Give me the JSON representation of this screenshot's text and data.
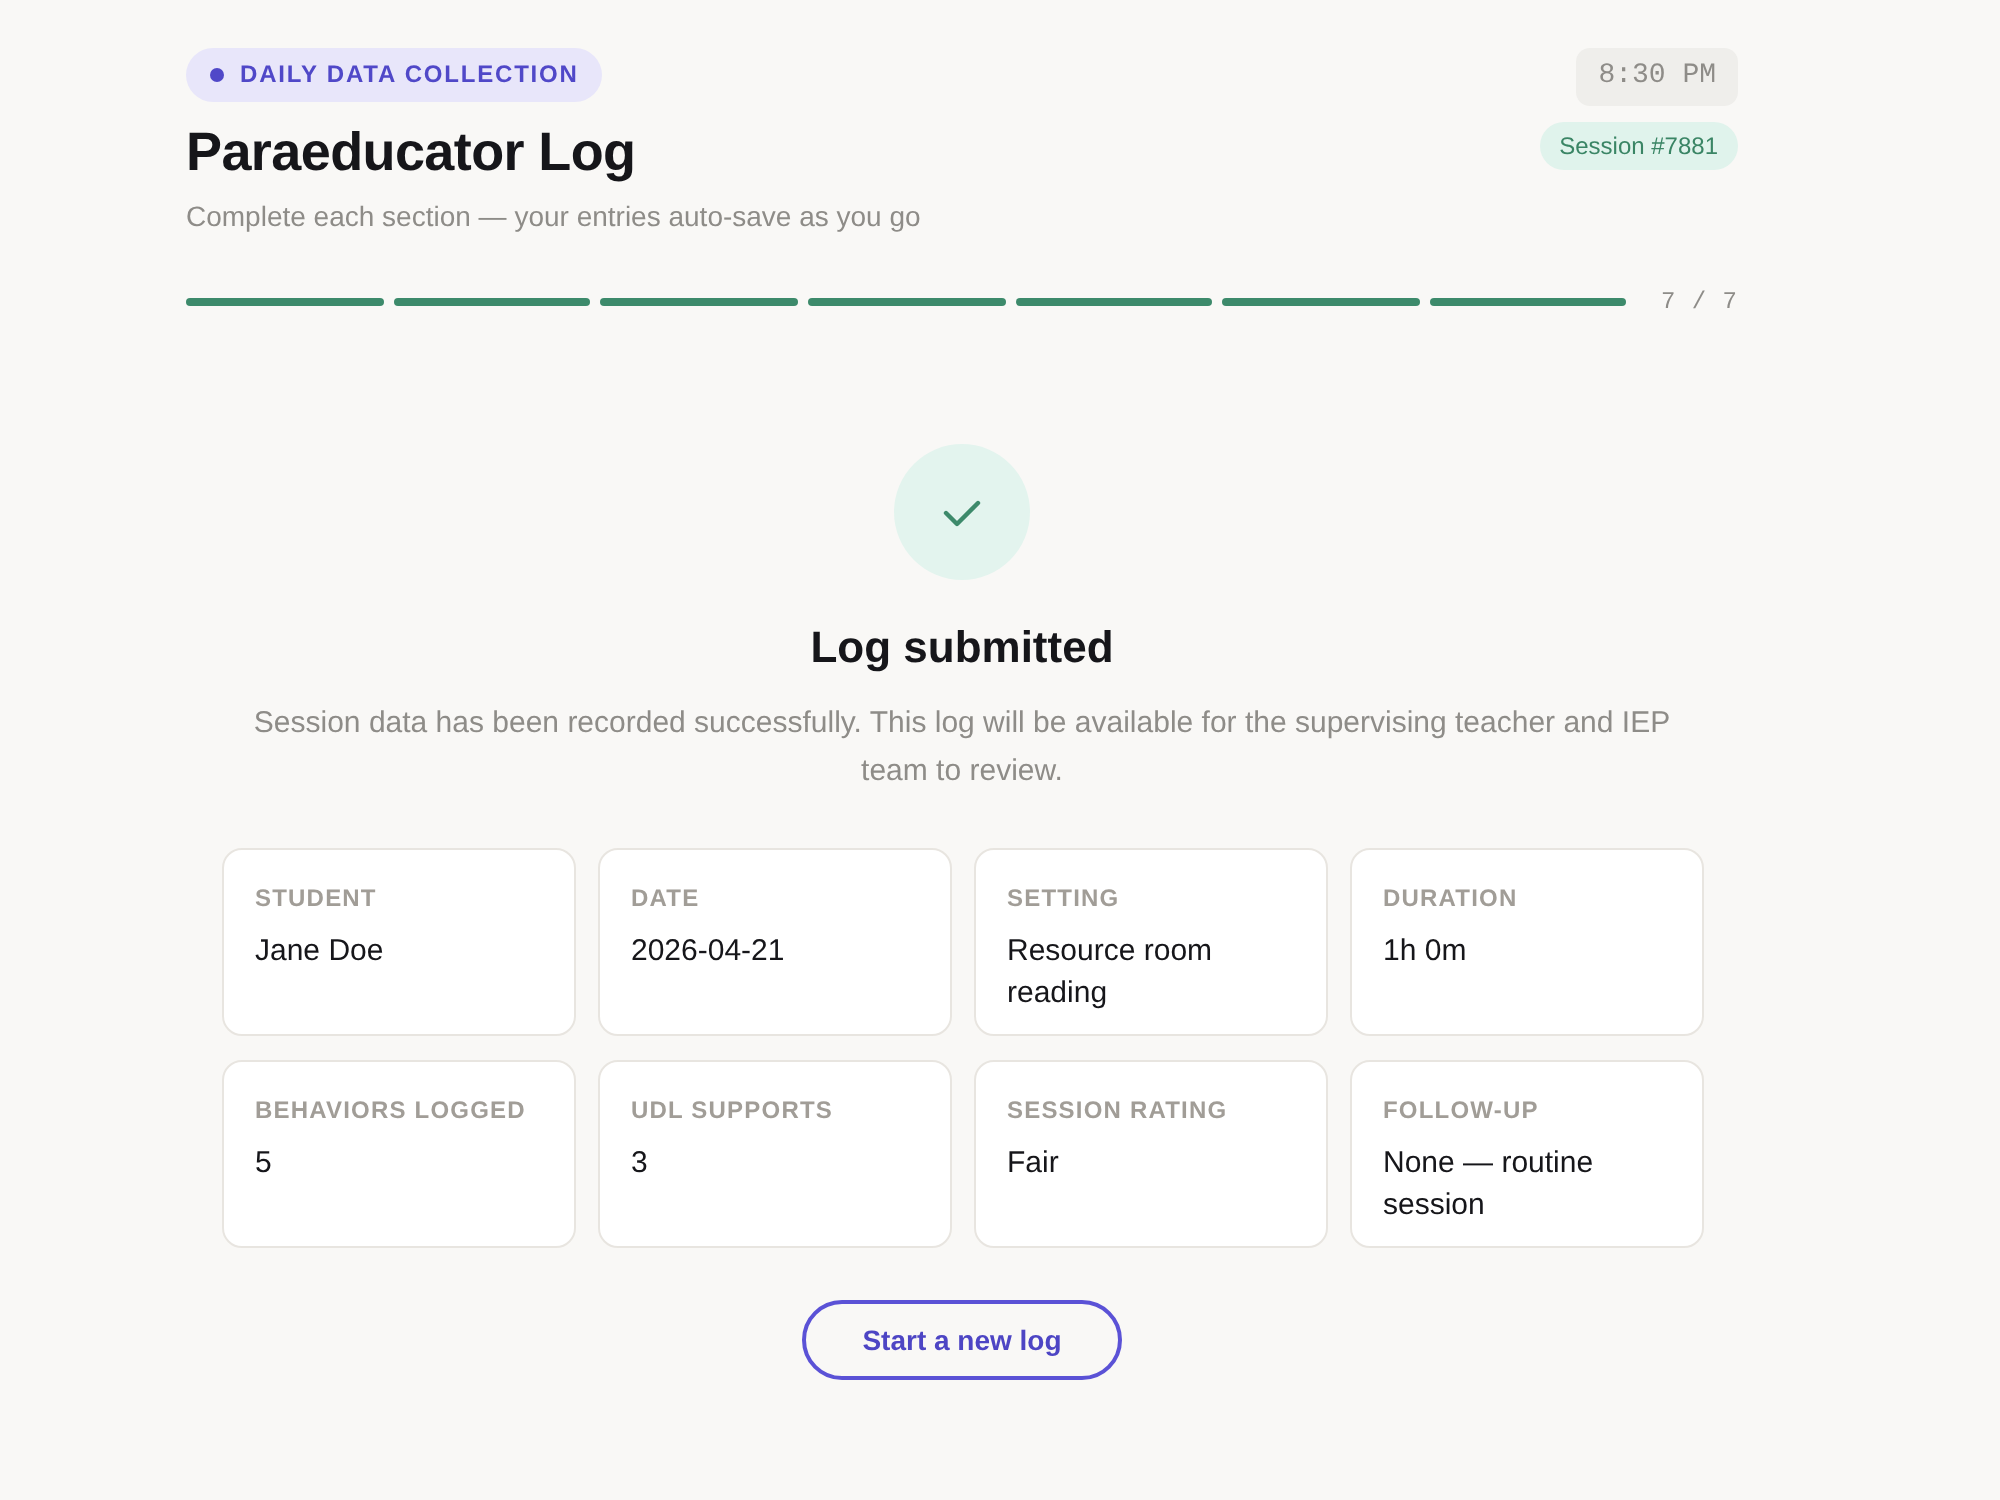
{
  "header": {
    "badge": "DAILY DATA COLLECTION",
    "title": "Paraeducator Log",
    "subtitle": "Complete each section — your entries auto-save as you go",
    "clock": "8:30 PM",
    "session": "Session #7881"
  },
  "progress": {
    "steps": [
      {
        "complete": true
      },
      {
        "complete": true
      },
      {
        "complete": true
      },
      {
        "complete": true
      },
      {
        "complete": true
      },
      {
        "complete": true
      },
      {
        "complete": true
      }
    ],
    "count": "7 / 7"
  },
  "confirmation": {
    "title": "Log submitted",
    "message": "Session data has been recorded successfully. This log will be available for the supervising teacher and IEP team to review."
  },
  "summary": [
    {
      "label": "STUDENT",
      "value": "Jane Doe"
    },
    {
      "label": "DATE",
      "value": "2026-04-21"
    },
    {
      "label": "SETTING",
      "value": "Resource room reading"
    },
    {
      "label": "DURATION",
      "value": "1h 0m"
    },
    {
      "label": "BEHAVIORS LOGGED",
      "value": "5"
    },
    {
      "label": "UDL SUPPORTS",
      "value": "3"
    },
    {
      "label": "SESSION RATING",
      "value": "Fair"
    },
    {
      "label": "FOLLOW-UP",
      "value": "None — routine session"
    }
  ],
  "actions": {
    "new_log": "Start a new log"
  }
}
